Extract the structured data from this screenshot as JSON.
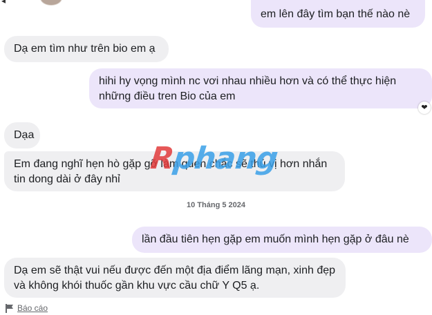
{
  "watermark": {
    "part1": "R",
    "part2": "phang"
  },
  "messages": [
    {
      "direction": "outgoing",
      "text": "em lên đây tìm bạn thế nào nè"
    },
    {
      "direction": "incoming",
      "text": "Dạ em tìm như trên bio em ạ"
    },
    {
      "direction": "outgoing",
      "text": "hihi hy vọng mình nc vơi nhau nhiều hơn và có thể thực hiện những điều tren Bio của em"
    },
    {
      "direction": "incoming",
      "text": "Dạa"
    },
    {
      "direction": "incoming",
      "text": "Em đang nghĩ hẹn hò gặp gỡ làm quen chắc sẽ thú vị hơn nhắn tin dong dài ở đây nhỉ"
    },
    {
      "direction": "outgoing",
      "text": "lần đầu tiên hẹn gặp em muốn mình hẹn gặp ở đâu nè"
    },
    {
      "direction": "incoming",
      "text": "Dạ em sẽ thật vui nếu được đến một địa điểm lãng mạn, xinh đẹp và không khói thuốc gần khu vực cầu chữ Y Q5 ạ."
    }
  ],
  "reaction": {
    "icon": "heart-icon",
    "symbol": "❤"
  },
  "date_separator": "10 Tháng 5 2024",
  "report": {
    "label": "Báo cáo",
    "icon": "flag-icon"
  },
  "colors": {
    "incoming_bubble": "#efeff1",
    "outgoing_bubble": "#ece5fa",
    "secondary_text": "#65676b"
  }
}
